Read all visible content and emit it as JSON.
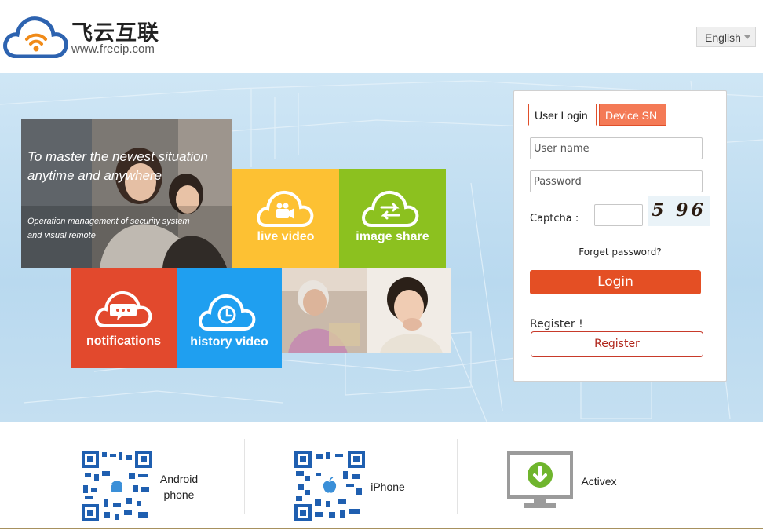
{
  "header": {
    "brand_name": "飞云互联",
    "brand_url": "www.freeip.com",
    "language": "English"
  },
  "banner": {
    "headline_line1": "To  master the newest situation",
    "headline_line2": "anytime and anywhere",
    "subline_line1": "Operation management of security system",
    "subline_line2": "and visual remote",
    "tiles": {
      "live_video": "live video",
      "image_share": "image share",
      "notifications": "notifications",
      "history_video": "history video"
    },
    "colors": {
      "live_video": "#fdc133",
      "image_share": "#8cc11f",
      "notifications": "#e2492d",
      "history_video": "#1f9ff0"
    }
  },
  "login": {
    "tab_user": "User Login",
    "tab_device": "Device SN",
    "username_placeholder": "User name",
    "password_placeholder": "Password",
    "captcha_label": "Captcha :",
    "captcha_text": "5 96",
    "forgot": "Forget password?",
    "login_button": "Login",
    "register_label": "Register !",
    "register_button": "Register",
    "accent": "#e44f24"
  },
  "footer": {
    "android_line1": "Android",
    "android_line2": "phone",
    "iphone": "iPhone",
    "activex": "Activex"
  }
}
